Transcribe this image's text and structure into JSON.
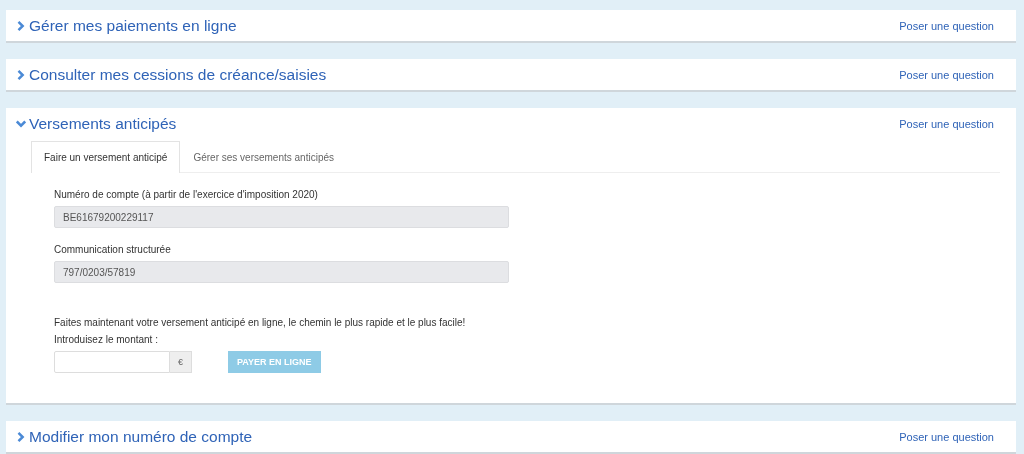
{
  "panels": [
    {
      "title": "Gérer mes paiements en ligne",
      "expanded": false,
      "link": "Poser une question"
    },
    {
      "title": "Consulter mes cessions de créance/saisies",
      "expanded": false,
      "link": "Poser une question"
    },
    {
      "title": "Versements anticipés",
      "expanded": true,
      "link": "Poser une question",
      "tabs": [
        {
          "label": "Faire un versement anticipé",
          "selected": true
        },
        {
          "label": "Gérer ses versements anticipés",
          "selected": false
        }
      ],
      "fields": [
        {
          "label": "Numéro de compte (à partir de l'exercice d'imposition 2020)",
          "value": "BE61679200229117"
        },
        {
          "label": "Communication structurée",
          "value": "797/0203/57819"
        }
      ],
      "intro": "Faites maintenant votre versement anticipé en ligne, le chemin le plus rapide et le plus facile!",
      "amount_label": "Introduisez le montant :",
      "currency": "€",
      "pay_button": {
        "label": "PAYER EN LIGNE",
        "disabled": true
      }
    },
    {
      "title": "Modifier mon numéro de compte",
      "expanded": false,
      "link": "Poser une question"
    }
  ]
}
